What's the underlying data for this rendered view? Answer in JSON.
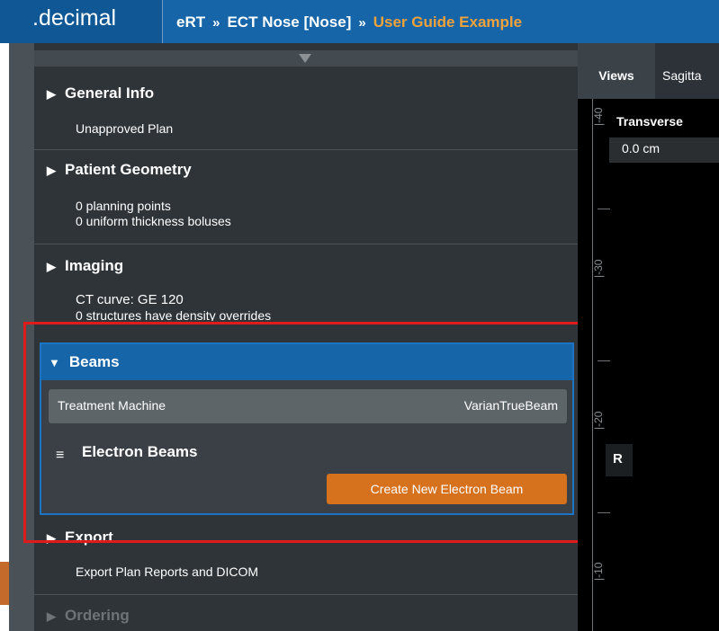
{
  "app": {
    "logo": ".decimal",
    "breadcrumb": [
      "eRT",
      "ECT Nose [Nose]",
      "User Guide Example"
    ],
    "breadcrumb_sep": "»"
  },
  "panel": {
    "general_info": {
      "title": "General Info",
      "lines": [
        "Unapproved Plan"
      ]
    },
    "patient_geometry": {
      "title": "Patient Geometry",
      "lines": [
        "0 planning points",
        "0 uniform thickness boluses"
      ]
    },
    "imaging": {
      "title": "Imaging",
      "lines": [
        "CT curve: GE 120",
        "0 structures have density overrides"
      ]
    },
    "beams": {
      "title": "Beams",
      "treatment_machine_label": "Treatment Machine",
      "treatment_machine_value": "VarianTrueBeam",
      "electron_beams_title": "Electron Beams",
      "create_button": "Create New Electron Beam"
    },
    "export": {
      "title": "Export",
      "lines": [
        "Export Plan Reports and DICOM"
      ]
    },
    "ordering": {
      "title": "Ordering"
    }
  },
  "viewer": {
    "tabs": [
      "Views",
      "Sagitta"
    ],
    "active_tab": "Views",
    "view_name": "Transverse",
    "depth": "0.0 cm",
    "orientation_marker": "R",
    "ruler_labels": [
      "|-40",
      "|-30",
      "|-20",
      "|-10"
    ]
  },
  "icons": {
    "collapsed": "triangle-right-icon",
    "expanded": "triangle-down-icon",
    "list": "list-icon",
    "scroll": "scroll-up-icon"
  },
  "colors": {
    "header": "#1565a8",
    "accent_text": "#f0a23a",
    "button": "#d6711e",
    "highlight": "#e01b1b",
    "panel_bg": "#2f3438"
  }
}
